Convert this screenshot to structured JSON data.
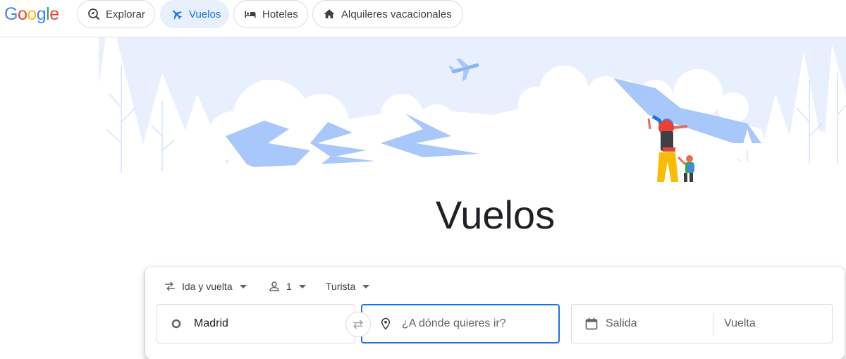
{
  "nav": {
    "logo": "Google",
    "items": [
      {
        "label": "Explorar",
        "icon": "explore-icon"
      },
      {
        "label": "Vuelos",
        "icon": "flight-icon",
        "active": true
      },
      {
        "label": "Hoteles",
        "icon": "hotel-icon"
      },
      {
        "label": "Alquileres vacacionales",
        "icon": "house-icon"
      }
    ]
  },
  "page_title": "Vuelos",
  "search": {
    "trip_type": "Ida y vuelta",
    "passengers": "1",
    "cabin_class": "Turista",
    "origin_value": "Madrid",
    "destination_placeholder": "¿A dónde quieres ir?",
    "departure_placeholder": "Salida",
    "return_placeholder": "Vuelta"
  },
  "colors": {
    "accent": "#1a73e8",
    "chip_active_bg": "#e8f0fe",
    "hero_sky": "#e8f0fe",
    "mountain_blue": "#a8c7fa"
  }
}
